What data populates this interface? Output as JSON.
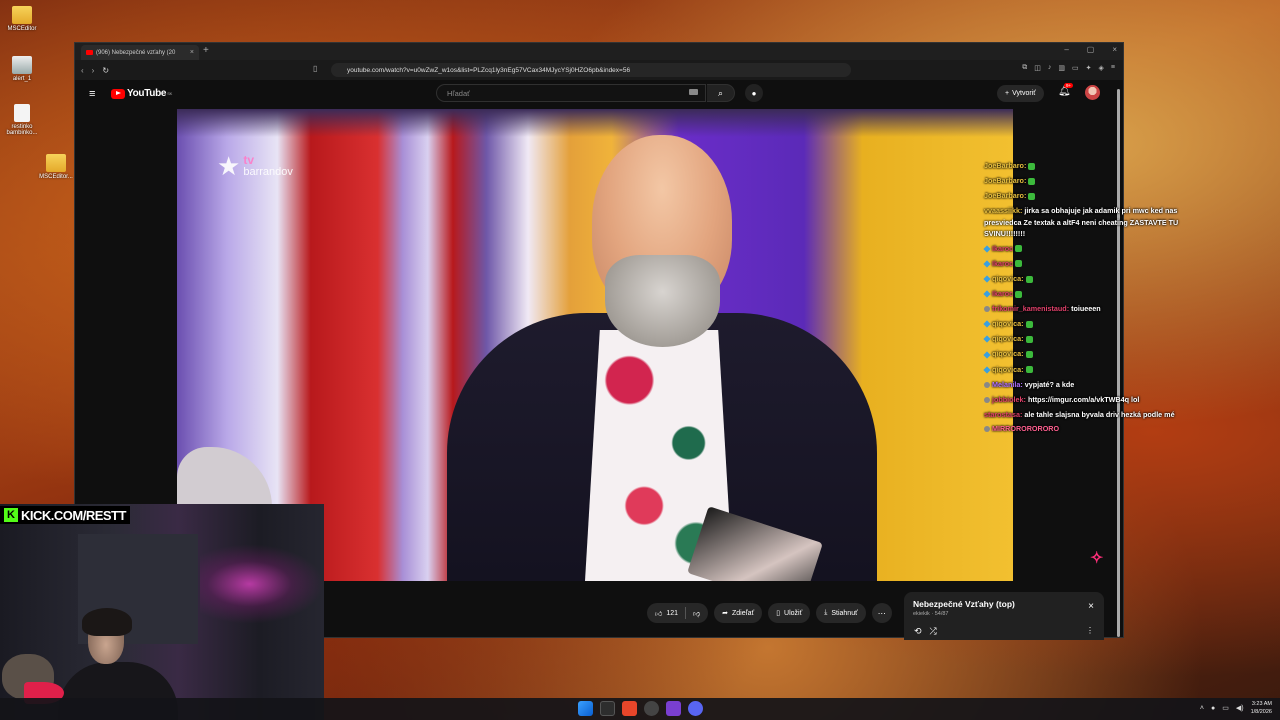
{
  "desktop": {
    "icons": [
      {
        "label": "MSCEditor"
      },
      {
        "label": "alert_1"
      },
      {
        "label": "restinko bambinko..."
      },
      {
        "label": "MSCEditor..."
      }
    ]
  },
  "browser": {
    "tab_title": "(906) Nebezpečné vzťahy (20",
    "url": "youtube.com/watch?v=u0wZwZ_w1os&list=PLZcq1ly3nEg57VCax34MJycYSj0HZO6pb&index=56"
  },
  "youtube": {
    "logo": "YouTube",
    "logo_sup": "SK",
    "search_placeholder": "Hľadať",
    "create_label": "Vytvoriť",
    "notif_badge": "9+"
  },
  "video": {
    "channel_logo": "tv",
    "channel_name": "barrandov"
  },
  "chat": [
    {
      "user": "JoeBarbaro:",
      "msg": "",
      "ucls": "cu",
      "emote": true
    },
    {
      "user": "JoeBarbaro:",
      "msg": "",
      "ucls": "cu",
      "emote": true
    },
    {
      "user": "JoeBarbaro:",
      "msg": "",
      "ucls": "cu",
      "emote": true
    },
    {
      "user": "vvaassiikk:",
      "msg": "jirka sa obhajuje jak adamik pri mwc ked nas presviedca Ze textak a altF4 neni cheating ZASTAVTE TU SVINU!!!!!!!!",
      "ucls": "cu",
      "wrap": true
    },
    {
      "user": "Ikaroc",
      "msg": "",
      "ucls": "cu red",
      "emote": true,
      "cube": true
    },
    {
      "user": "Ikaroc",
      "msg": "",
      "ucls": "cu red",
      "emote": true,
      "cube": true
    },
    {
      "user": "qiqovica:",
      "msg": "",
      "ucls": "cu",
      "emote": true,
      "cube": true
    },
    {
      "user": "Ikaroc",
      "msg": "",
      "ucls": "cu red",
      "emote": true,
      "cube": true
    },
    {
      "user": "frikomir_kamenistaud:",
      "msg": "toiueeen",
      "ucls": "cu red"
    },
    {
      "user": "qiqovica:",
      "msg": "",
      "ucls": "cu",
      "emote": true,
      "cube": true
    },
    {
      "user": "qiqovica:",
      "msg": "",
      "ucls": "cu",
      "emote": true,
      "cube": true
    },
    {
      "user": "qiqovica:",
      "msg": "",
      "ucls": "cu",
      "emote": true,
      "cube": true
    },
    {
      "user": "qiqovica:",
      "msg": "",
      "ucls": "cu",
      "emote": true,
      "cube": true
    },
    {
      "user": "Melanila:",
      "msg": "vypjaté? a kde",
      "ucls": "cu purple"
    },
    {
      "user": "jobbiolek:",
      "msg": "https://imgur.com/a/vkTWB4q lol",
      "ucls": "cu red"
    },
    {
      "user": "starostasa:",
      "msg": "ale tahle slajsna byvala driv hezká podle mé",
      "ucls": "cu red",
      "wrap": true
    },
    {
      "user": "MIRRORORORORO",
      "msg": "",
      "ucls": "cu pink"
    }
  ],
  "actions": {
    "likes": "121",
    "share": "Zdieľať",
    "save": "Uložiť",
    "download": "Stiahnuť"
  },
  "playlist": {
    "title": "Nebezpečné Vzťahy (top)",
    "subtitle": "ekiekik · 54/87"
  },
  "overlay": {
    "kick_url": "KICK.COM/RESTT"
  },
  "taskbar": {
    "time": "3:23 AM",
    "date": "1/8/2026"
  },
  "colors": {
    "youtube_red": "#ff0000",
    "kick_green": "#53fc18",
    "chat_username": "#e8c040"
  }
}
